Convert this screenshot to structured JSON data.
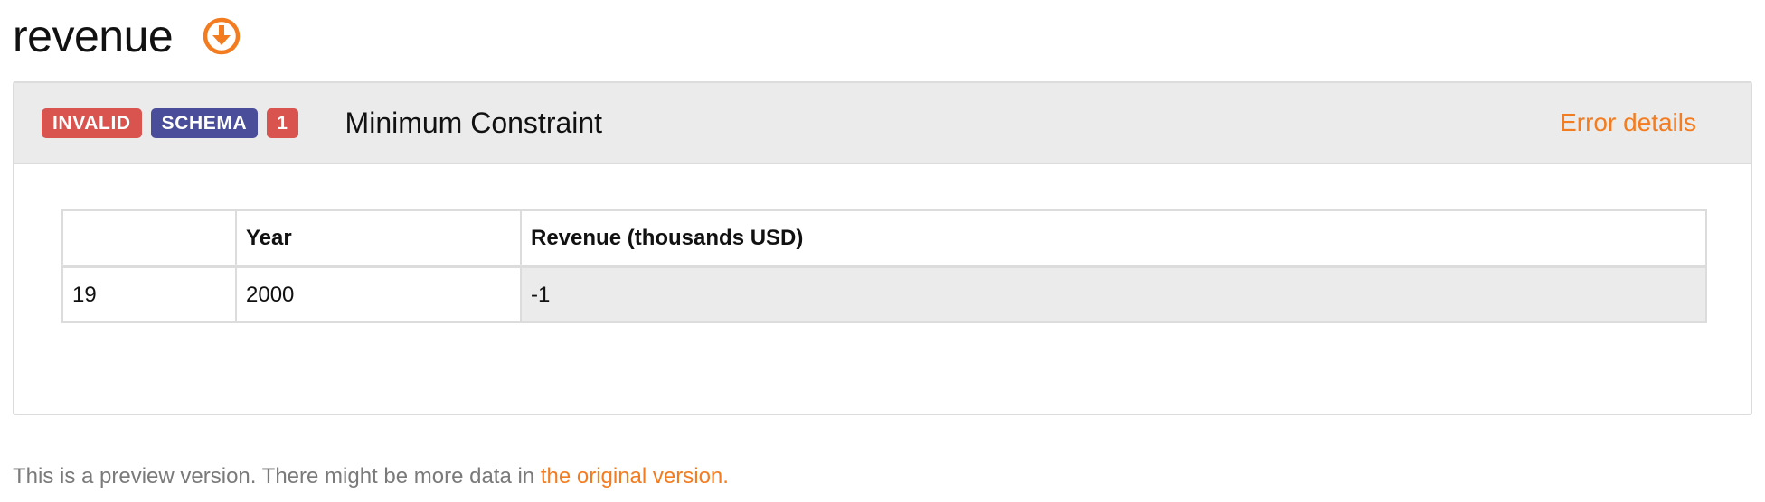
{
  "resource": {
    "title": "revenue",
    "download_icon": "download-circle-icon",
    "accent_color": "#f47c20"
  },
  "error_group": {
    "badges": {
      "invalid": "INVALID",
      "schema": "SCHEMA",
      "count": "1"
    },
    "badge_colors": {
      "invalid": "#d9534f",
      "schema": "#4a4e9a",
      "count": "#d9534f"
    },
    "title": "Minimum Constraint",
    "details_link": "Error details"
  },
  "table": {
    "headers": [
      "",
      "Year",
      "Revenue (thousands USD)"
    ],
    "rows": [
      {
        "row_number": "19",
        "cells": [
          "2000",
          "-1"
        ]
      }
    ]
  },
  "footer": {
    "note_text": "This is a preview version. There might be more data in ",
    "link_text": "the original version."
  }
}
